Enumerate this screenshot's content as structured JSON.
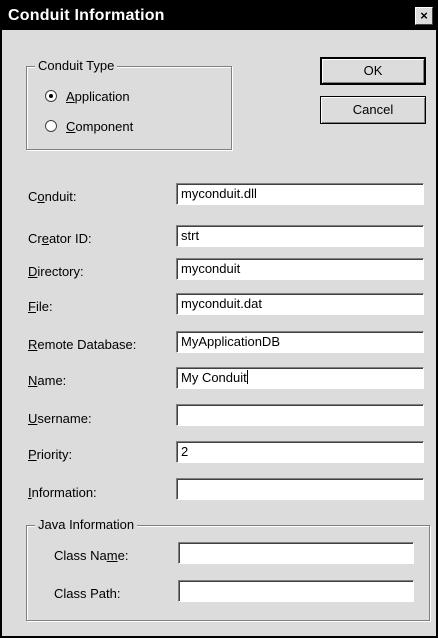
{
  "window": {
    "title": "Conduit Information",
    "close_glyph": "×"
  },
  "conduit_type": {
    "label": "Conduit Type",
    "options": [
      {
        "pre": "",
        "key": "A",
        "post": "pplication",
        "selected": true
      },
      {
        "pre": "",
        "key": "C",
        "post": "omponent",
        "selected": false
      }
    ]
  },
  "buttons": {
    "ok": "OK",
    "cancel": "Cancel"
  },
  "fields": [
    {
      "pre": "C",
      "key": "o",
      "post": "nduit:",
      "value": "myconduit.dll"
    },
    {
      "pre": "Cr",
      "key": "e",
      "post": "ator ID:",
      "value": "strt"
    },
    {
      "pre": "",
      "key": "D",
      "post": "irectory:",
      "value": "myconduit"
    },
    {
      "pre": "",
      "key": "F",
      "post": "ile:",
      "value": "myconduit.dat"
    },
    {
      "pre": "",
      "key": "R",
      "post": "emote Database:",
      "value": "MyApplicationDB"
    },
    {
      "pre": "",
      "key": "N",
      "post": "ame:",
      "value": "My Conduit"
    },
    {
      "pre": "",
      "key": "U",
      "post": "sername:",
      "value": ""
    },
    {
      "pre": "",
      "key": "P",
      "post": "riority:",
      "value": "2"
    },
    {
      "pre": "",
      "key": "I",
      "post": "nformation:",
      "value": ""
    }
  ],
  "java_info": {
    "label": "Java Information",
    "class_name": {
      "pre": "Class Na",
      "key": "m",
      "post": "e:",
      "value": ""
    },
    "class_path": {
      "pre": "Class Path:",
      "key": "",
      "post": "",
      "value": ""
    }
  }
}
